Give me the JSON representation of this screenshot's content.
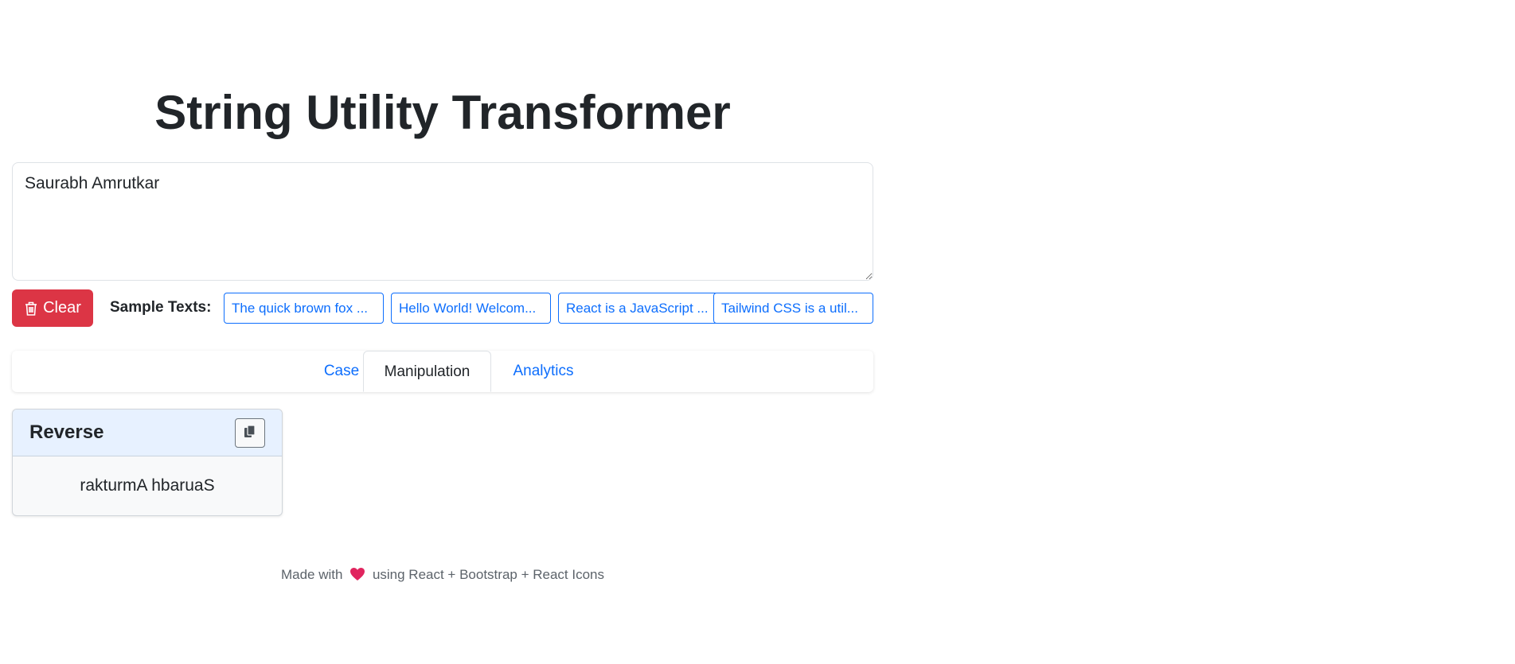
{
  "header": {
    "title": "String Utility Transformer"
  },
  "input": {
    "value": "Saurabh Amrutkar"
  },
  "controls": {
    "clear_label": "Clear",
    "sample_label": "Sample Texts:",
    "samples": [
      "The quick brown fox ...",
      "Hello World! Welcom...",
      "React is a JavaScript ...",
      "Tailwind CSS is a util..."
    ]
  },
  "tabs": [
    {
      "label": "Case",
      "active": false
    },
    {
      "label": "Manipulation",
      "active": true
    },
    {
      "label": "Analytics",
      "active": false
    }
  ],
  "result": {
    "title": "Reverse",
    "value": "rakturmA hbaruaS"
  },
  "footer": {
    "prefix": "Made with",
    "suffix": "using React + Bootstrap + React Icons"
  },
  "colors": {
    "danger": "#dc3545",
    "primary": "#0d6efd",
    "heart": "#e0245e"
  },
  "icons": {
    "clear": "trash-icon",
    "copy": "copy-icon",
    "footer": "heart-icon"
  }
}
